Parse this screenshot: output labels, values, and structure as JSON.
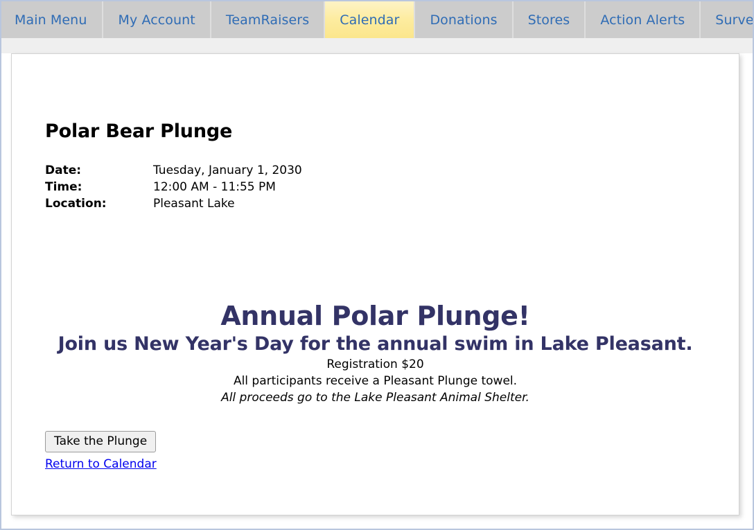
{
  "nav": {
    "tabs": [
      {
        "label": "Main Menu",
        "active": false
      },
      {
        "label": "My Account",
        "active": false
      },
      {
        "label": "TeamRaisers",
        "active": false
      },
      {
        "label": "Calendar",
        "active": true
      },
      {
        "label": "Donations",
        "active": false
      },
      {
        "label": "Stores",
        "active": false
      },
      {
        "label": "Action Alerts",
        "active": false
      },
      {
        "label": "Survey",
        "active": false
      }
    ],
    "tab_text_color": "#2f6cb5",
    "tab_bg_color": "#cccccc",
    "active_tab_bg_color": "#fbe68c"
  },
  "event": {
    "title": "Polar Bear Plunge",
    "details": [
      {
        "label": "Date:",
        "value": "Tuesday, January 1, 2030"
      },
      {
        "label": "Time:",
        "value": "12:00 AM - 11:55 PM"
      },
      {
        "label": "Location:",
        "value": "Pleasant Lake"
      }
    ]
  },
  "promo": {
    "headline": "Annual Polar Plunge!",
    "subheadline": "Join us New Year's Day for the annual swim in Lake Pleasant.",
    "lines": [
      "Registration $20",
      "All participants receive a Pleasant Plunge towel."
    ],
    "italic_line": "All proceeds go to the Lake Pleasant Animal Shelter.",
    "heading_color": "#333366"
  },
  "actions": {
    "primary_button": "Take the Plunge",
    "back_link": "Return to Calendar",
    "link_color": "#0000ee"
  }
}
